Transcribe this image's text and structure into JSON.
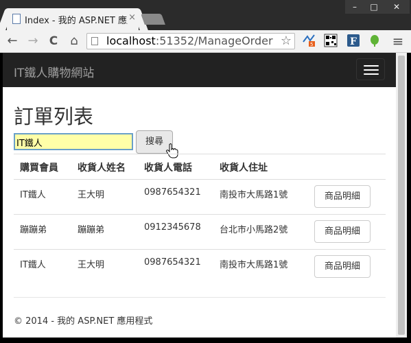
{
  "browser": {
    "tab_title": "Index - 我的 ASP.NET 應用",
    "tab_close": "×",
    "url_host": "localhost",
    "url_rest": ":51352/ManageOrder",
    "window_controls": {
      "min": "–",
      "max": "□",
      "close": "✕"
    },
    "nav": {
      "back": "←",
      "forward": "→",
      "reload": "C",
      "home": "⌂"
    },
    "star": "☆",
    "menu": "≡"
  },
  "navbar": {
    "brand": "IT鐵人購物網站"
  },
  "page": {
    "title": "訂單列表",
    "search_value": "IT鐵人",
    "search_button": "搜尋"
  },
  "table": {
    "headers": [
      "購買會員",
      "收貨人姓名",
      "收貨人電話",
      "收貨人住址"
    ],
    "rows": [
      {
        "member": "IT鐵人",
        "name": "王大明",
        "phone": "0987654321",
        "address": "南投市大馬路1號",
        "button": "商品明細"
      },
      {
        "member": "蹦蹦弟",
        "name": "蹦蹦弟",
        "phone": "0912345678",
        "address": "台北市小馬路2號",
        "button": "商品明細"
      },
      {
        "member": "IT鐵人",
        "name": "王大明",
        "phone": "0987654321",
        "address": "南投市大馬路1號",
        "button": "商品明細"
      }
    ]
  },
  "footer": {
    "text": "© 2014 - 我的 ASP.NET 應用程式"
  },
  "colors": {
    "navbar": "#222222",
    "brand": "#9d9d9d",
    "input_bg": "#ffffa8",
    "accent": "#6aa0c8"
  }
}
